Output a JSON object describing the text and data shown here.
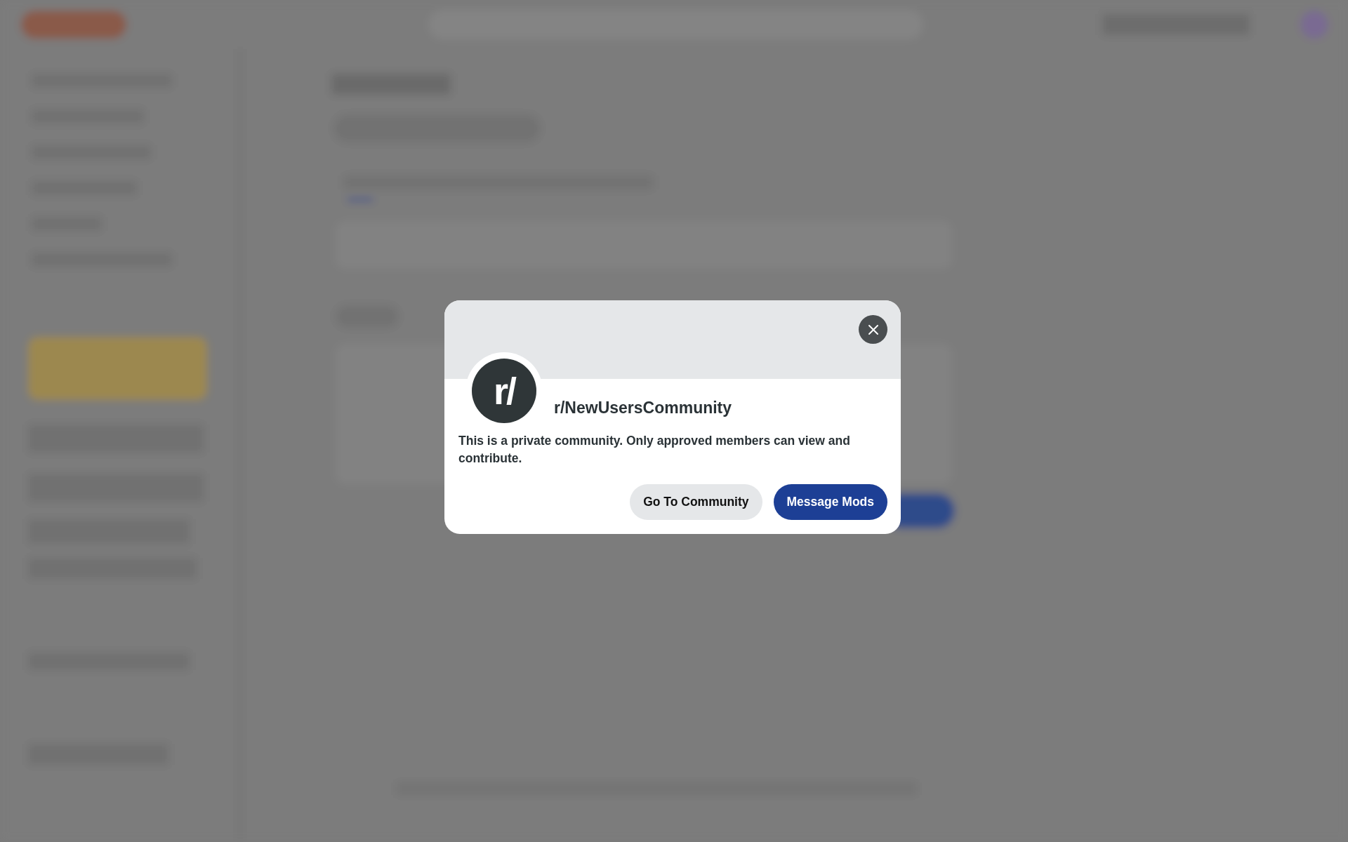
{
  "modal": {
    "avatar_text": "r/",
    "community_name": "r/NewUsersCommunity",
    "message": "This is a private community. Only approved members can view and contribute.",
    "buttons": [
      {
        "label": "Go To Community",
        "kind": "secondary"
      },
      {
        "label": "Message Mods",
        "kind": "primary"
      }
    ]
  }
}
